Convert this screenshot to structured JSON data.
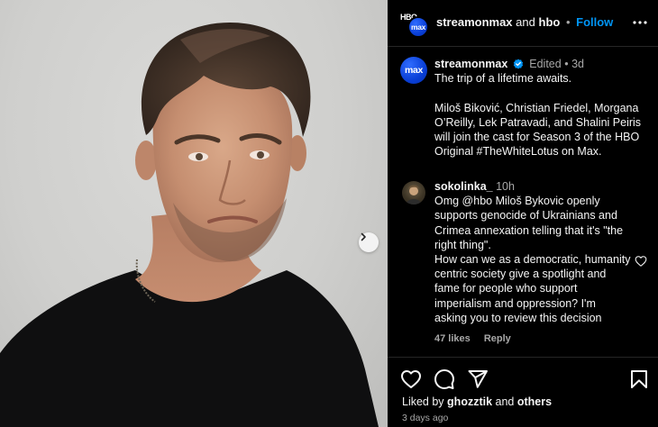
{
  "post": {
    "author": "streamonmax",
    "header_and": "and",
    "coauthor": "hbo",
    "follow_label": "Follow",
    "avatar_text": "max",
    "hbo_text": "HBO",
    "icons": [
      "more-horizontal-icon",
      "verified-badge-icon",
      "chevron-right-icon",
      "heart-icon",
      "comment-icon",
      "share-icon",
      "bookmark-icon"
    ]
  },
  "caption": {
    "user": "streamonmax",
    "edited": "Edited",
    "time": "3d",
    "text": "The trip of a lifetime awaits.\n\nMiloš Biković, Christian Friedel, Morgana O’Reilly, Lek Patravadi, and Shalini Peiris will join the cast for Season 3 of the HBO Original #TheWhiteLotus on Max."
  },
  "comment": {
    "user": "sokolinka_",
    "time": "10h",
    "text": "Omg @hbo Miloš Bykovic openly supports genocide of Ukrainians and Crimea annexation telling that it's \"the right thing\".\nHow can we as a democratic, humanity centric society give a spotlight and fame for people who support imperialism and oppression? I'm asking you to review this decision",
    "likes": "47 likes",
    "reply": "Reply"
  },
  "footer": {
    "liked_by_prefix": "Liked by",
    "liked_by_user": "ghozztik",
    "liked_by_and": "and",
    "liked_by_others": "others",
    "date": "3 days ago"
  },
  "colors": {
    "accent": "#0095f6",
    "max_blue": "#0a3fd6",
    "muted": "#a8a8a8",
    "background": "#000000"
  }
}
